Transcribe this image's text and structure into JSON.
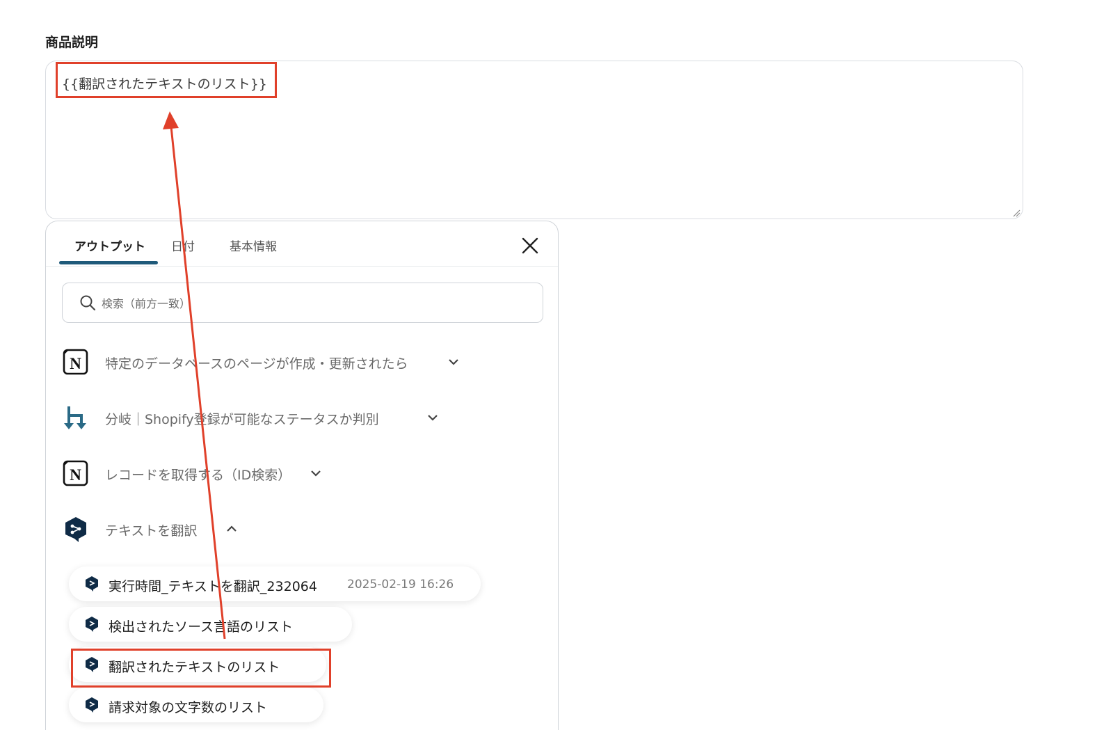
{
  "field": {
    "label": "商品説明",
    "value": "{{翻訳されたテキストのリスト}}"
  },
  "panel": {
    "tabs": [
      {
        "label": "アウトプット",
        "active": true
      },
      {
        "label": "日付",
        "active": false
      },
      {
        "label": "基本情報",
        "active": false
      }
    ],
    "search": {
      "placeholder": "検索（前方一致）",
      "value": ""
    },
    "groups": [
      {
        "icon": "notion-icon",
        "label": "特定のデータベースのページが作成・更新されたら",
        "expanded": false
      },
      {
        "icon": "branch-icon",
        "label": "分岐｜Shopify登録が可能なステータスか判別",
        "expanded": false
      },
      {
        "icon": "notion-icon",
        "label": "レコードを取得する（ID検索）",
        "expanded": false
      },
      {
        "icon": "deepl-icon",
        "label": "テキストを翻訳",
        "expanded": true
      }
    ],
    "outputs": [
      {
        "label": "実行時間_テキストを翻訳_232064",
        "time": "2025-02-19 16:26"
      },
      {
        "label": "検出されたソース言語のリスト",
        "time": ""
      },
      {
        "label": "翻訳されたテキストのリスト",
        "time": ""
      },
      {
        "label": "請求対象の文字数のリスト",
        "time": ""
      }
    ]
  },
  "colors": {
    "highlight": "#e0402a",
    "tab_underline": "#1f5a7a",
    "deepl": "#0f2b46",
    "branch": "#2a6a86"
  }
}
